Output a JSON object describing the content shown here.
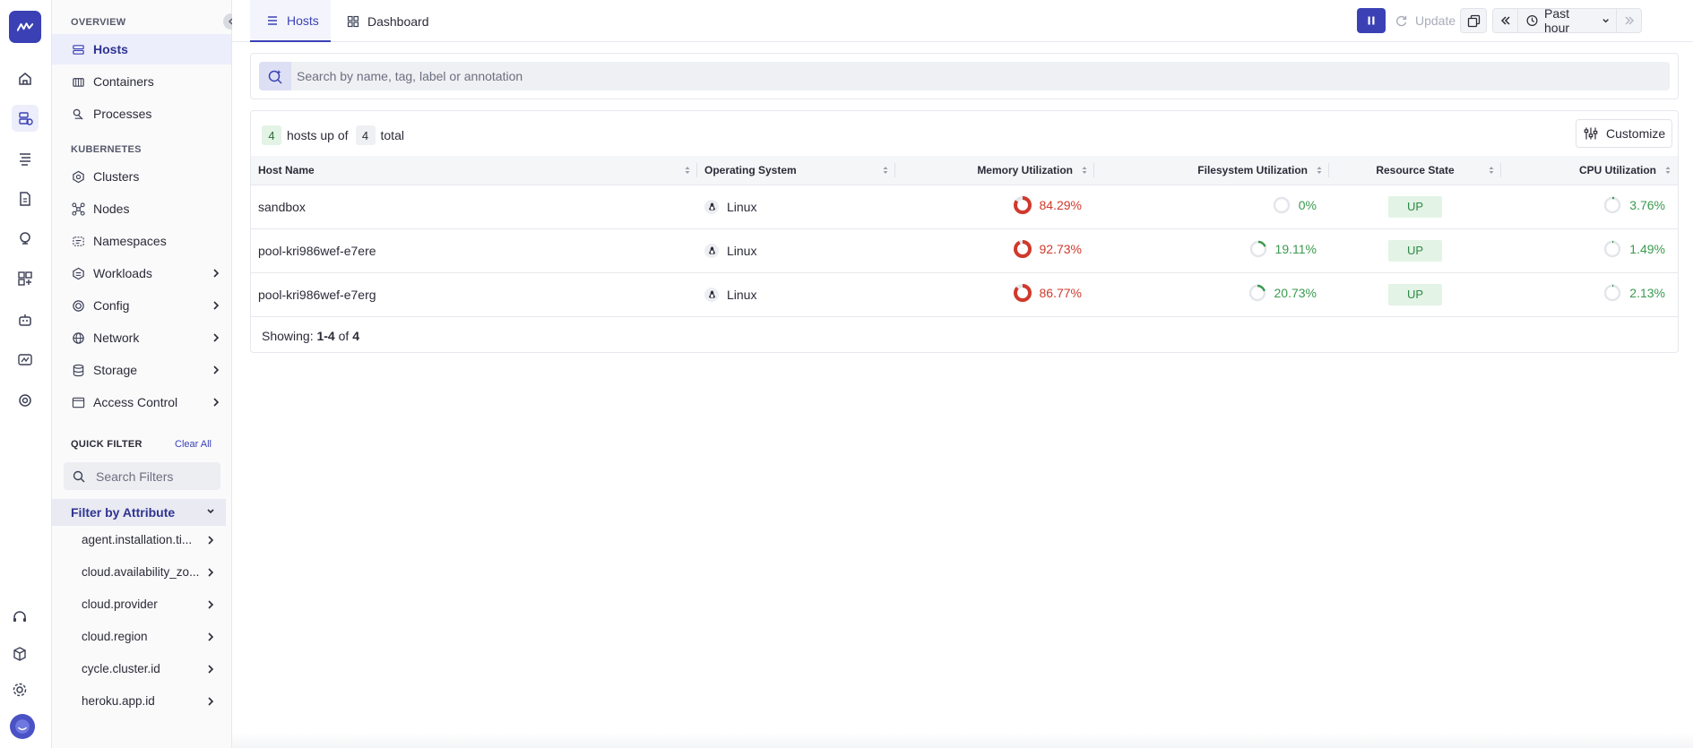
{
  "nav": {
    "overview_label": "OVERVIEW",
    "overview_items": [
      {
        "label": "Hosts",
        "icon": "server-icon"
      },
      {
        "label": "Containers",
        "icon": "container-icon"
      },
      {
        "label": "Processes",
        "icon": "process-icon"
      }
    ],
    "kubernetes_label": "KUBERNETES",
    "kubernetes_items": [
      {
        "label": "Clusters",
        "icon": "cluster-icon"
      },
      {
        "label": "Nodes",
        "icon": "nodes-icon"
      },
      {
        "label": "Namespaces",
        "icon": "namespace-icon"
      },
      {
        "label": "Workloads",
        "icon": "workloads-icon"
      },
      {
        "label": "Config",
        "icon": "config-icon"
      },
      {
        "label": "Network",
        "icon": "globe-icon"
      },
      {
        "label": "Storage",
        "icon": "database-icon"
      },
      {
        "label": "Access Control",
        "icon": "window-icon"
      }
    ],
    "quick_filter_label": "QUICK FILTER",
    "clear_all_label": "Clear All",
    "search_filters_placeholder": "Search Filters",
    "filter_by_attribute_label": "Filter by Attribute",
    "attributes": [
      "agent.installation.ti...",
      "cloud.availability_zo...",
      "cloud.provider",
      "cloud.region",
      "cycle.cluster.id",
      "heroku.app.id"
    ]
  },
  "topbar": {
    "tabs": [
      {
        "label": "Hosts",
        "active": true
      },
      {
        "label": "Dashboard",
        "active": false
      }
    ],
    "update_label": "Update",
    "time_range": "Past hour"
  },
  "search": {
    "placeholder": "Search by name, tag, label or annotation"
  },
  "summary": {
    "hosts_up": "4",
    "hosts_up_text": "hosts up of",
    "total": "4",
    "total_text": "total",
    "customize_label": "Customize"
  },
  "table": {
    "columns": [
      "Host Name",
      "Operating System",
      "Memory Utilization",
      "Filesystem Utilization",
      "Resource State",
      "CPU Utilization"
    ],
    "rows": [
      {
        "host": "sandbox",
        "os": "Linux",
        "memory": "84.29%",
        "memory_pct": 84.29,
        "filesystem": "0%",
        "filesystem_pct": 0,
        "state": "UP",
        "cpu": "3.76%",
        "cpu_pct": 3.76
      },
      {
        "host": "pool-kri986wef-e7ere",
        "os": "Linux",
        "memory": "92.73%",
        "memory_pct": 92.73,
        "filesystem": "19.11%",
        "filesystem_pct": 19.11,
        "state": "UP",
        "cpu": "1.49%",
        "cpu_pct": 1.49
      },
      {
        "host": "pool-kri986wef-e7erg",
        "os": "Linux",
        "memory": "86.77%",
        "memory_pct": 86.77,
        "filesystem": "20.73%",
        "filesystem_pct": 20.73,
        "state": "UP",
        "cpu": "2.13%",
        "cpu_pct": 2.13
      }
    ]
  },
  "footer": {
    "showing_prefix": "Showing:",
    "showing_range": "1-4",
    "showing_of": "of",
    "showing_total": "4"
  },
  "colors": {
    "accent": "#3b41b5",
    "danger": "#d0392b",
    "success": "#3a9a4f"
  }
}
